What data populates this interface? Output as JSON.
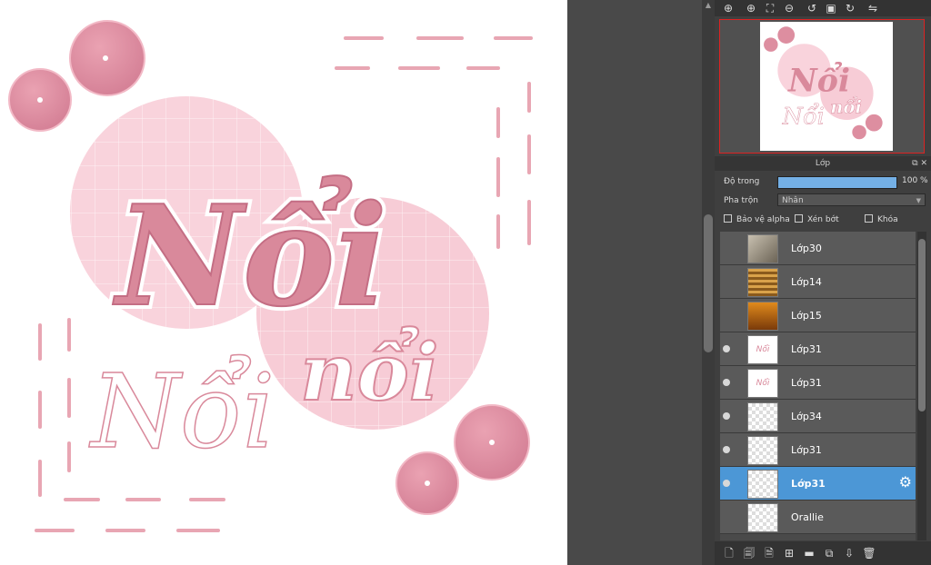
{
  "canvas": {
    "main_word": "Nổi",
    "secondary_word": "nổi",
    "outline_word": "Nổi",
    "colors": {
      "pink": "#d9899b",
      "light_pink": "#f9d3dc",
      "dash": "#e8a6b3"
    }
  },
  "navigator_toolbar": {
    "icons": [
      "zoom-fit-icon",
      "zoom-in-icon",
      "fit-window-icon",
      "zoom-out-icon",
      "rotate-left-icon",
      "fullscreen-icon",
      "rotate-right-icon",
      "flip-icon"
    ]
  },
  "layer_panel": {
    "title": "Lớp",
    "opacity_label": "Độ trong",
    "opacity_value": "100 %",
    "opacity_fraction": 1.0,
    "blend_label": "Pha trộn",
    "blend_value": "Nhân",
    "protect_alpha_label": "Bảo vệ alpha",
    "clipping_label": "Xén bớt",
    "lock_label": "Khóa",
    "layers": [
      {
        "name": "Lớp30",
        "visible": false,
        "thumb": "photo-gray"
      },
      {
        "name": "Lớp14",
        "visible": false,
        "thumb": "photo-blinds"
      },
      {
        "name": "Lớp15",
        "visible": false,
        "thumb": "photo-orange"
      },
      {
        "name": "Lớp31",
        "visible": true,
        "thumb": "art"
      },
      {
        "name": "Lớp31",
        "visible": true,
        "thumb": "art"
      },
      {
        "name": "Lớp34",
        "visible": true,
        "thumb": "transparent"
      },
      {
        "name": "Lớp31",
        "visible": true,
        "thumb": "transparent"
      },
      {
        "name": "Lớp31",
        "visible": true,
        "thumb": "transparent",
        "selected": true
      },
      {
        "name": "Orallie",
        "visible": false,
        "thumb": "transparent"
      }
    ]
  }
}
